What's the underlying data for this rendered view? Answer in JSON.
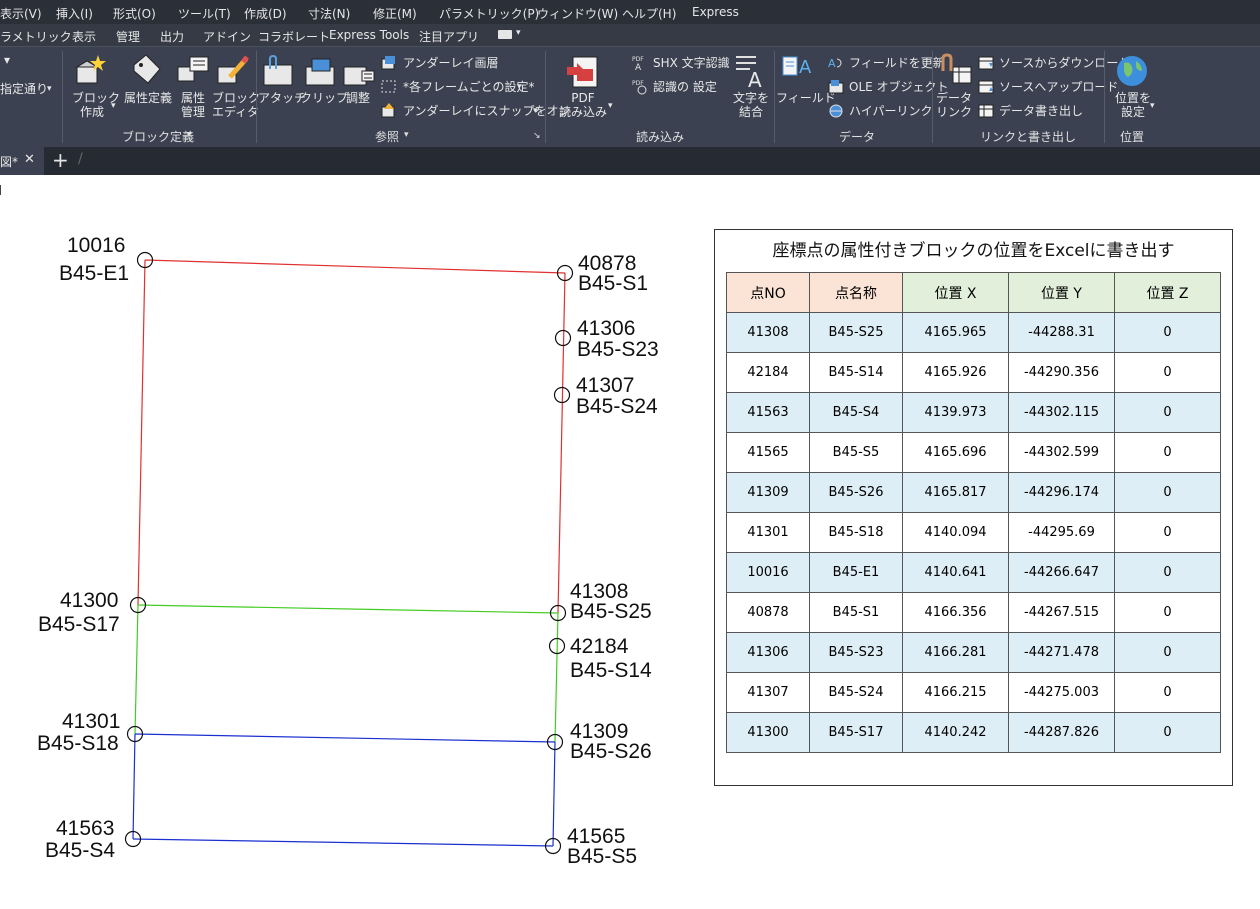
{
  "menu": [
    "表示(V)",
    "挿入(I)",
    "形式(O)",
    "ツール(T)",
    "作成(D)",
    "寸法(N)",
    "修正(M)",
    "パラメトリック(P)",
    "ウィンドウ(W)",
    "ヘルプ(H)",
    "Express"
  ],
  "ribbon_tabs": [
    "ラメトリック",
    "表示",
    "管理",
    "出力",
    "アドイン",
    "コラボレート",
    "Express Tools",
    "注目アプリ"
  ],
  "ribbon": {
    "left_cut": "指定通り",
    "block": {
      "create": [
        "ブロック",
        "作成"
      ],
      "attdef": "属性定義",
      "attmgr": [
        "属性",
        "管理"
      ],
      "editor": [
        "ブロック",
        "エディタ"
      ],
      "panel": "ブロック定義"
    },
    "ref": {
      "attach": "アタッチ",
      "clip": "クリップ",
      "adjust": "調整",
      "underlay_layers": "アンダーレイ画層",
      "frames": "*各フレームごとの設定*",
      "snap": "アンダーレイにスナップをオン",
      "panel": "参照"
    },
    "import": {
      "pdf": [
        "PDF",
        "読み込み"
      ],
      "shx": "SHX 文字認識",
      "recog": "認識の 設定",
      "combine": [
        "文字を",
        "結合"
      ],
      "panel": "読み込み"
    },
    "data": {
      "field": "フィールド",
      "update_fields": "フィールドを更新",
      "ole": "OLE オブジェクト",
      "hyperlink": "ハイパーリンク",
      "panel": "データ"
    },
    "link": {
      "datalink": [
        "データ",
        "リンク"
      ],
      "download": "ソースからダウンロード",
      "upload": "ソースへアップロード",
      "extract": "データ書き出し",
      "panel": "リンクと書き出し"
    },
    "location": {
      "set": [
        "位置を",
        "設定"
      ],
      "panel": "位置"
    }
  },
  "doc_tab": "図*",
  "drawing": {
    "points": [
      {
        "no": "10016",
        "name": "B45-E1"
      },
      {
        "no": "40878",
        "name": "B45-S1"
      },
      {
        "no": "41306",
        "name": "B45-S23"
      },
      {
        "no": "41307",
        "name": "B45-S24"
      },
      {
        "no": "41300",
        "name": "B45-S17"
      },
      {
        "no": "41308",
        "name": "B45-S25"
      },
      {
        "no": "42184",
        "name": "B45-S14"
      },
      {
        "no": "41301",
        "name": "B45-S18"
      },
      {
        "no": "41309",
        "name": "B45-S26"
      },
      {
        "no": "41563",
        "name": "B45-S4"
      },
      {
        "no": "41565",
        "name": "B45-S5"
      }
    ],
    "colors": {
      "red": "#e03030",
      "green": "#44cc22",
      "blue": "#1a2fd0"
    }
  },
  "table": {
    "title": "座標点の属性付きブロックの位置をExcelに書き出す",
    "headers": [
      "点NO",
      "点名称",
      "位置 X",
      "位置 Y",
      "位置 Z"
    ],
    "rows": [
      [
        "41308",
        "B45-S25",
        "4165.965",
        "-44288.31",
        "0"
      ],
      [
        "42184",
        "B45-S14",
        "4165.926",
        "-44290.356",
        "0"
      ],
      [
        "41563",
        "B45-S4",
        "4139.973",
        "-44302.115",
        "0"
      ],
      [
        "41565",
        "B45-S5",
        "4165.696",
        "-44302.599",
        "0"
      ],
      [
        "41309",
        "B45-S26",
        "4165.817",
        "-44296.174",
        "0"
      ],
      [
        "41301",
        "B45-S18",
        "4140.094",
        "-44295.69",
        "0"
      ],
      [
        "10016",
        "B45-E1",
        "4140.641",
        "-44266.647",
        "0"
      ],
      [
        "40878",
        "B45-S1",
        "4166.356",
        "-44267.515",
        "0"
      ],
      [
        "41306",
        "B45-S23",
        "4166.281",
        "-44271.478",
        "0"
      ],
      [
        "41307",
        "B45-S24",
        "4166.215",
        "-44275.003",
        "0"
      ],
      [
        "41300",
        "B45-S17",
        "4140.242",
        "-44287.826",
        "0"
      ]
    ],
    "header_colors": [
      "#fbe4d5",
      "#fbe4d5",
      "#e2efda",
      "#e2efda",
      "#e2efda"
    ],
    "row_alt_color": "#deeef6"
  }
}
